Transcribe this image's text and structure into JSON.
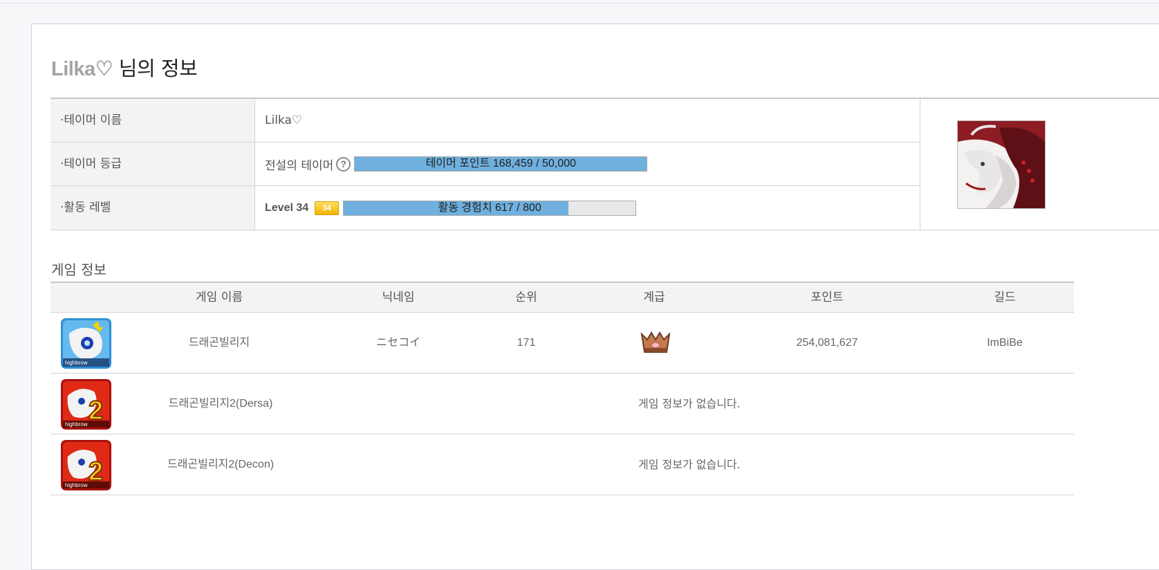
{
  "title": {
    "nickname": "Lilka♡",
    "suffix": " 님의 정보"
  },
  "tamer": {
    "rows": [
      {
        "label": "·테이머 이름",
        "value": "Lilka♡"
      },
      {
        "label": "·테이머 등급",
        "grade": "전설의 테이머",
        "help": "?",
        "bar_text": "테이머 포인트 168,459 / 50,000",
        "bar_fill": 1.0
      },
      {
        "label": "·활동 레벨",
        "level": "Level 34",
        "badge": "34",
        "bar_text": "활동 경험치 617 / 800",
        "bar_fill": 0.77
      }
    ]
  },
  "games": {
    "section_title": "게임 정보",
    "columns": [
      "게임 이름",
      "닉네임",
      "순위",
      "계급",
      "포인트",
      "길드"
    ],
    "rows": [
      {
        "name": "드래곤빌리지",
        "nickname": "ニセコイ",
        "rank": "171",
        "rank_icon": "crown-icon",
        "points": "254,081,627",
        "guild": "ImBiBe"
      },
      {
        "name": "드래곤빌리지2(Dersa)",
        "nodata": "게임 정보가 없습니다."
      },
      {
        "name": "드래곤빌리지2(Decon)",
        "nodata": "게임 정보가 없습니다."
      }
    ],
    "icon_brand": "highbrow"
  },
  "colors": {
    "bar_fill": "#6fb0df",
    "badge": "#f2b500"
  }
}
